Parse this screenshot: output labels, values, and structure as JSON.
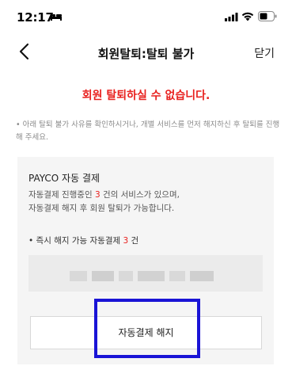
{
  "status_bar": {
    "time": "12:17",
    "icons": [
      "bed-icon",
      "signal-icon",
      "wifi-icon",
      "battery-icon"
    ]
  },
  "header": {
    "back_icon": "chevron-left-icon",
    "title": "회원탈퇴:탈퇴 불가",
    "close_label": "닫기"
  },
  "main": {
    "error_message": "회원 탈퇴하실 수 없습니다.",
    "notice": "• 아래 탈퇴 불가 사유를 확인하시거나, 개별 서비스를 먼저 해지하신 후 탈퇴를 진행해 주세요.",
    "payment_box": {
      "title": "PAYCO 자동 결제",
      "desc_line1_before": "자동결제 진행중인 ",
      "desc_line1_count": "3",
      "desc_line1_after": " 건의 서비스가 있으며,",
      "desc_line2": "자동결제 해지 후 회원 탈퇴가 가능합니다.",
      "bullet_before": "• 즉시 해지 가능 자동결제 ",
      "bullet_count": "3",
      "bullet_after": " 건",
      "button_label": "자동결제 해지"
    }
  },
  "colors": {
    "error_red": "#e8201e",
    "highlight_blue": "#1a14d6",
    "box_bg": "#f5f5f5"
  }
}
